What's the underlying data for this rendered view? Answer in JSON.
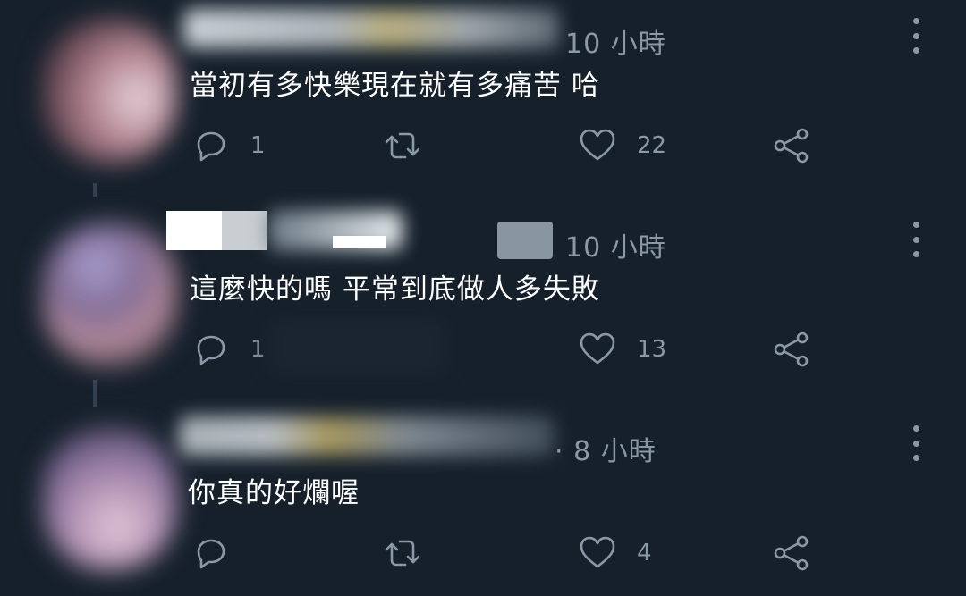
{
  "tweets": [
    {
      "time": "10 小時",
      "text": "當初有多快樂現在就有多痛苦 哈",
      "reply_count": "1",
      "like_count": "22",
      "reply_icon": "reply-icon",
      "retweet_icon": "retweet-icon",
      "like_icon": "heart-icon",
      "share_icon": "share-icon",
      "more_icon": "more-vertical-icon"
    },
    {
      "time": "10 小時",
      "text": "這麼快的嗎 平常到底做人多失敗",
      "reply_count": "1",
      "like_count": "13",
      "reply_icon": "reply-icon",
      "retweet_icon": "retweet-icon",
      "like_icon": "heart-icon",
      "share_icon": "share-icon",
      "more_icon": "more-vertical-icon"
    },
    {
      "time": "· 8 小時",
      "text": "你真的好爛喔",
      "reply_count": "",
      "like_count": "4",
      "reply_icon": "reply-icon",
      "retweet_icon": "retweet-icon",
      "like_icon": "heart-icon",
      "share_icon": "share-icon",
      "more_icon": "more-vertical-icon"
    }
  ],
  "colors": {
    "background": "#15202b",
    "secondary_text": "#8b98a5",
    "primary_text": "#ffffff"
  }
}
